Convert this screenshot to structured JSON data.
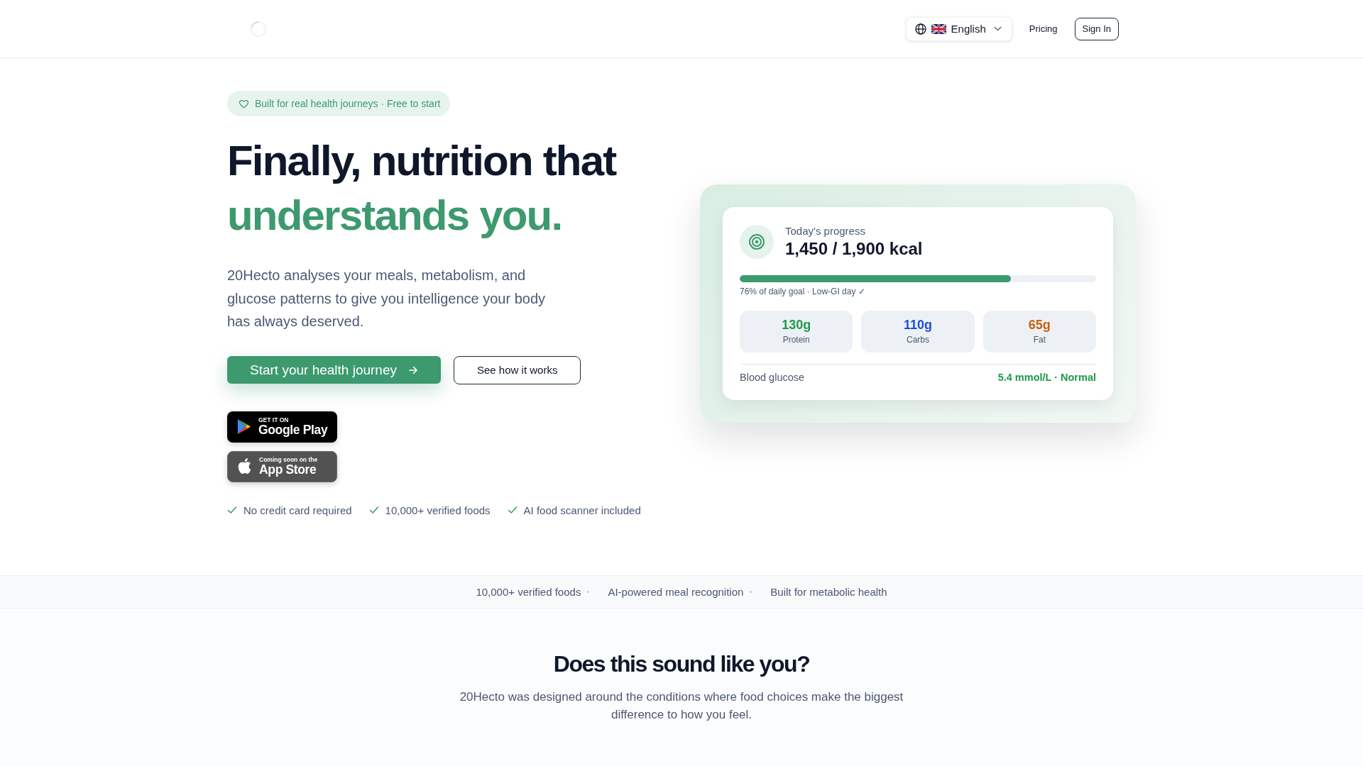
{
  "header": {
    "language": "English",
    "nav_links": [
      "Pricing"
    ],
    "sign_in": "Sign In"
  },
  "hero": {
    "tagline": "Built for real health journeys · Free to start",
    "headline": {
      "lead": "Finally, nutrition that",
      "highlight": "understands you."
    },
    "description": "20Hecto analyses your meals, metabolism, and glucose patterns to give you intelligence your body has always deserved.",
    "primary_button": "Start your health journey",
    "secondary_button": "See how it works",
    "store_badges": [
      {
        "kind": "google_play",
        "caption": "GET IT ON",
        "store": "Google Play"
      },
      {
        "kind": "app_store",
        "caption": "Coming soon on the",
        "store": "App Store"
      }
    ],
    "perks": [
      "No credit card required",
      "10,000+ verified foods",
      "AI food scanner included"
    ]
  },
  "progress_card": {
    "title": "Today's progress",
    "value": "1,450 / 1,900 kcal",
    "level": 0.76,
    "caption": "76% of daily goal · Low-GI day ✓",
    "macros": [
      {
        "value": "130g",
        "label": "Protein",
        "color": "#1f9a48"
      },
      {
        "value": "110g",
        "label": "Carbs",
        "color": "#1d4ed8"
      },
      {
        "value": "65g",
        "label": "Fat",
        "color": "#c8600f"
      }
    ],
    "glucose": {
      "label": "Blood glucose",
      "reading": "5.4 mmol/L · Normal"
    }
  },
  "highlights_strip": [
    "10,000+ verified foods",
    "AI-powered meal recognition",
    "Built for metabolic health"
  ],
  "conditions_section": {
    "title": "Does this sound like you?",
    "subtitle": "20Hecto was designed around the conditions where food choices make the biggest difference to how you feel."
  }
}
